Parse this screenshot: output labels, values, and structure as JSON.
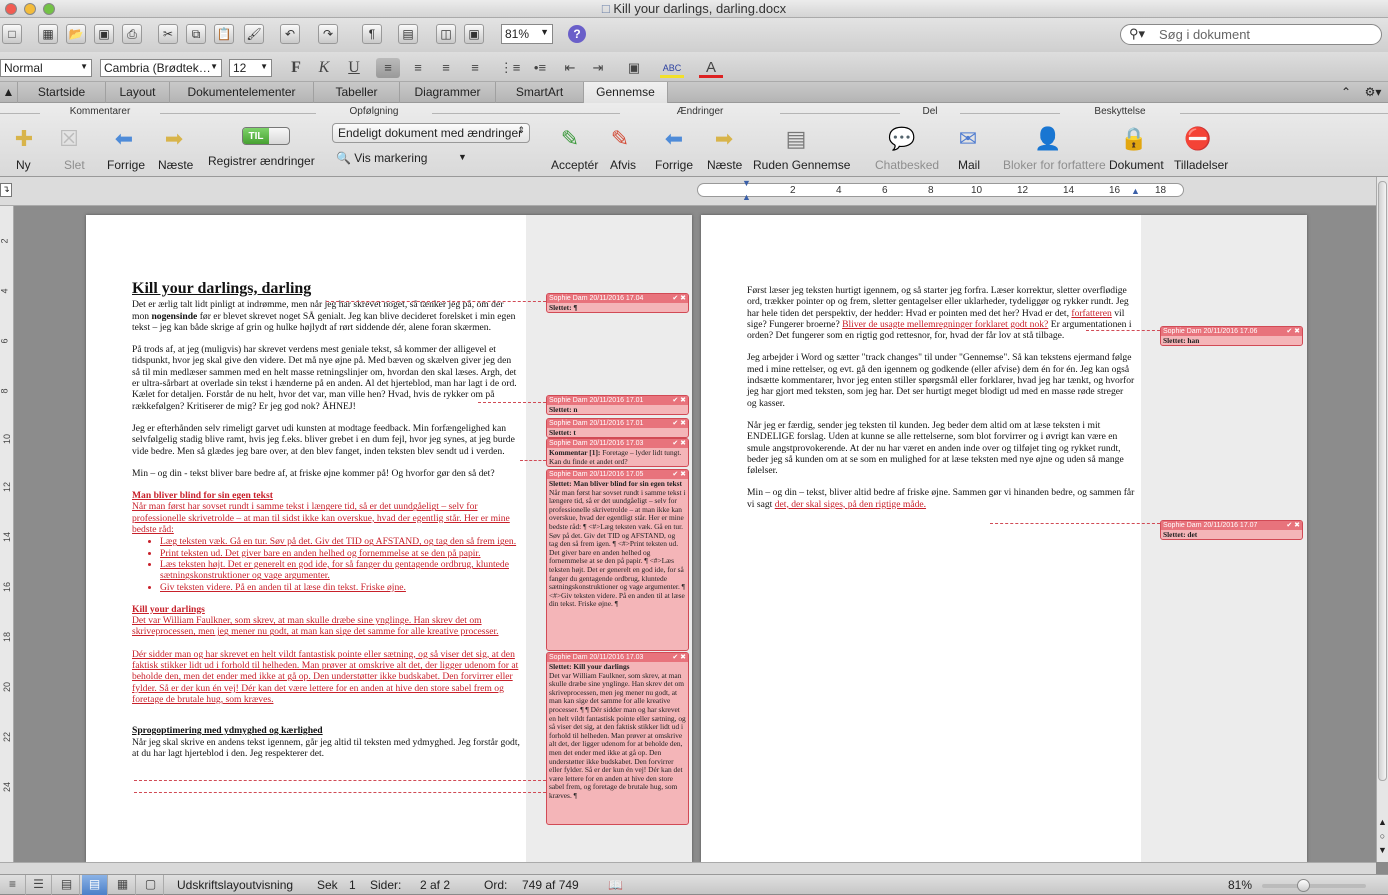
{
  "window": {
    "title": "Kill your darlings, darling.docx"
  },
  "toolbar": {
    "zoom": "81%",
    "search_placeholder": "Søg i dokument"
  },
  "format": {
    "style": "Normal",
    "font": "Cambria (Brødtek…",
    "size": "12"
  },
  "tabs": [
    "Startside",
    "Layout",
    "Dokumentelementer",
    "Tabeller",
    "Diagrammer",
    "SmartArt",
    "Gennemse"
  ],
  "active_tab": "Gennemse",
  "ribbon": {
    "groups": {
      "kommentarer": "Kommentarer",
      "opfolgning": "Opfølgning",
      "aendringer": "Ændringer",
      "del": "Del",
      "beskyttelse": "Beskyttelse"
    },
    "ny": "Ny",
    "slet": "Slet",
    "forrige": "Forrige",
    "naeste": "Næste",
    "toggle_label": "TIL",
    "registrer": "Registrer ændringer",
    "endelig": "Endeligt dokument med ændringer",
    "vis_markering": "Vis markering",
    "accepter": "Acceptér",
    "afvis": "Afvis",
    "forrige2": "Forrige",
    "naeste2": "Næste",
    "ruden": "Ruden Gennemse",
    "chatbesked": "Chatbesked",
    "mail": "Mail",
    "bloker": "Bloker for forfattere",
    "dokument": "Dokument",
    "tilladelser": "Tilladelser"
  },
  "ruler": {
    "labels": [
      "2",
      "4",
      "6",
      "8",
      "10",
      "12",
      "14",
      "16",
      "18"
    ]
  },
  "vruler": {
    "labels": [
      "2",
      "4",
      "6",
      "8",
      "10",
      "12",
      "14",
      "16",
      "18",
      "20",
      "22",
      "24"
    ]
  },
  "page1": {
    "title": "Kill your darlings, darling",
    "p1a": "Det er ærlig talt lidt pinligt at indrømme, men når jeg har skrevet noget, så tænker jeg på, om der mon ",
    "p1b": "nogensinde",
    "p1c": " før er blevet skrevet noget SÅ genialt. Jeg kan blive decideret forelsket i min egen tekst – jeg kan både skrige af grin og hulke højlydt af rørt siddende dér, alene foran skærmen.",
    "p2": "På trods af, at jeg (muligvis) har skrevet verdens mest geniale tekst, så kommer der alligevel et tidspunkt, hvor jeg skal give den videre. Det må nye øjne på. Med bæven og skælven giver jeg den så til min medlæser sammen med en helt masse retningslinjer om, hvordan den skal læses. Argh, det er ultra-sårbart at overlade sin tekst i hænderne på en anden. Al det hjerteblod, man har lagt i de ord. Kælet for detaljen. Forstår de nu helt, hvor det var, man ville hen? Hvad, hvis de rykker om på rækkefølgen? Kritiserer de mig? Er jeg god nok? ÅHNEJ!",
    "p3": "Jeg er efterhånden selv rimeligt garvet udi kunsten at modtage feedback. Min forfængelighed kan selvfølgelig stadig blive ramt, hvis jeg f.eks. bliver grebet i en dum fejl, hvor jeg synes, at jeg burde vide bedre. Men så glædes jeg bare over, at den blev fanget, inden teksten blev sendt ud i verden.",
    "p4": "Min – og din - tekst bliver bare bedre af, at friske øjne kommer på! Og hvorfor gør den så det?",
    "h_blind": "Man bliver blind for sin egen tekst",
    "p_blind": "Når man først har sovset rundt i samme tekst i længere tid, så er det uundgåeligt – selv for professionelle skrivetrolde – at man til sidst ikke kan overskue, hvad der egentlig står. Her er mine bedste råd:",
    "bullets": [
      "Læg teksten væk.  Gå en tur. Søv på det. Giv det TID og AFSTAND, og tag den så frem igen.",
      "Print teksten ud. Det giver bare en anden helhed og fornemmelse at se den på papir.",
      "Læs teksten højt. Det er generelt en god ide, for så fanger du gentagende ordbrug, kluntede sætningskonstruktioner og vage argumenter.",
      "Giv teksten videre. På en anden til at læse din tekst. Friske øjne."
    ],
    "h_kill": "Kill your darlings",
    "p_kill1": "Det var William Faulkner, som skrev, at man skulle dræbe sine ynglinge. Han skrev det om skriveprocessen, men jeg mener nu godt, at man kan sige det samme for alle kreative processer.",
    "p_kill2": "Dér sidder man og har skrevet en helt vildt fantastisk pointe eller sætning, og så viser det sig, at den faktisk stikker lidt ud i forhold til helheden. Man prøver at omskrive alt det, der ligger udenom for at beholde den, men det ender med ikke at gå op. Den understøtter ikke budskabet. Den forvirrer eller fylder. Så er der kun én vej! Dér kan det være lettere for en anden at hive den store sabel frem og foretage de brutale hug, som kræves.",
    "h_sprog": "Sprogoptimering med ydmyghed og kærlighed",
    "p_sprog": "Når jeg skal skrive en andens tekst igennem, går jeg altid til teksten med ydmyghed. Jeg forstår godt, at du har lagt hjerteblod i den. Jeg respekterer det."
  },
  "page2": {
    "p1a": "Først læser jeg teksten hurtigt igennem, og så starter jeg forfra. Læser korrektur, sletter overflødige ord, trækker pointer op og frem, sletter gentagelser eller uklarheder, tydeliggør og rykker rundt. Jeg har hele tiden det perspektiv, der hedder: Hvad er pointen med det her? Hvad er det, ",
    "p1b": "forfatteren",
    "p1c": " vil sige? Fungerer broerne? ",
    "p1d": "Bliver de usagte mellemregninger forklaret godt nok?",
    "p1e": " Er argumentationen i orden? Det fungerer som en rigtig god rettesnor, for, hvad der får lov at stå tilbage.",
    "p2": "Jeg arbejder i Word og sætter \"track changes\" til under \"Gennemse\". Så kan tekstens ejermand følge med i mine rettelser, og evt. gå den igennem og godkende (eller afvise) dem én for én. Jeg kan også indsætte kommentarer, hvor jeg enten stiller spørgsmål eller forklarer, hvad jeg har tænkt, og hvorfor jeg har gjort med teksten, som jeg har. Det ser hurtigt meget blodigt ud med en masse røde streger og kasser.",
    "p3": "Når jeg er færdig, sender jeg teksten til kunden. Jeg beder dem altid om at læse teksten i mit ENDELIGE forslag. Uden at kunne se alle rettelserne, som blot forvirrer og i øvrigt kan være en smule angstprovokerende. At der nu har været en anden inde over og tilføjet ting og rykket rundt, beder jeg så kunden om at se som en mulighed for at læse teksten med nye øjne og uden så mange følelser.",
    "p4a": "Min – og din – tekst, bliver altid bedre af friske øjne. Sammen gør vi hinanden bedre, og sammen får vi sagt ",
    "p4b": "det, der skal siges, på den rigtige måde."
  },
  "balloons": {
    "b1": {
      "head": "Sophie Dam 20/11/2016 17.04",
      "body": "Slettet: ¶"
    },
    "b2": {
      "head": "Sophie Dam 20/11/2016 17.01",
      "body": "Slettet: n"
    },
    "b3": {
      "head": "Sophie Dam 20/11/2016 17.01",
      "body": "Slettet: t"
    },
    "b4": {
      "head": "Sophie Dam 20/11/2016 17.03",
      "label": "Kommentar [1]:",
      "body": "Foretage – lyder lidt tungt. Kan du finde et andet ord?"
    },
    "b5": {
      "head": "Sophie Dam 20/11/2016 17.05",
      "label": "Slettet: Man bliver blind for sin egen tekst",
      "body": "Når man først har sovset rundt i samme tekst i længere tid, så er det uundgåeligt – selv for professionelle skrivetrolde – at man ikke kan overskue, hvad der egentligt står. Her er mine bedste råd: ¶ <#>Læg teksten væk.  Gå en tur. Søv på det. Giv det TID og AFSTAND, og tag den så frem igen. ¶ <#>Print teksten ud. Det giver bare en anden helhed og fornemmelse at se den på papir. ¶ <#>Læs teksten højt. Det er generelt en god ide, for så fanger du gentagende ordbrug, kluntede sætningskonstruktioner og vage argumenter. ¶ <#>Giv teksten videre. På en anden til at læse din tekst. Friske øjne. ¶"
    },
    "b6": {
      "head": "Sophie Dam 20/11/2016 17.03",
      "label": "Slettet: Kill your darlings",
      "body": "Det var William Faulkner, som skrev, at man skulle dræbe sine ynglinge. Han skrev det om skriveprocessen, men jeg mener nu godt, at man kan sige det samme for alle kreative processer. ¶ ¶ Dér sidder man og har skrevet en helt vildt fantastisk pointe eller sætning, og så viser det sig, at den faktisk stikker lidt ud i forhold til helheden. Man prøver at omskrive alt det, der ligger udenom for at beholde den, men det ender med ikke at gå op. Den understøtter ikke budskabet. Den forvirrer eller fylder. Så er der kun én vej! Dér kan det være lettere for en anden at hive den store sabel frem, og foretage de brutale hug, som kræves. ¶"
    },
    "b7": {
      "head": "Sophie Dam 20/11/2016 17.06",
      "body": "Slettet: han"
    },
    "b8": {
      "head": "Sophie Dam 20/11/2016 17.07",
      "body": "Slettet: det"
    }
  },
  "status": {
    "view": "Udskriftslayoutvisning",
    "sek_label": "Sek",
    "sek_val": "1",
    "sider_label": "Sider:",
    "sider_val": "2 af 2",
    "ord_label": "Ord:",
    "ord_val": "749 af 749",
    "zoom": "81%"
  }
}
